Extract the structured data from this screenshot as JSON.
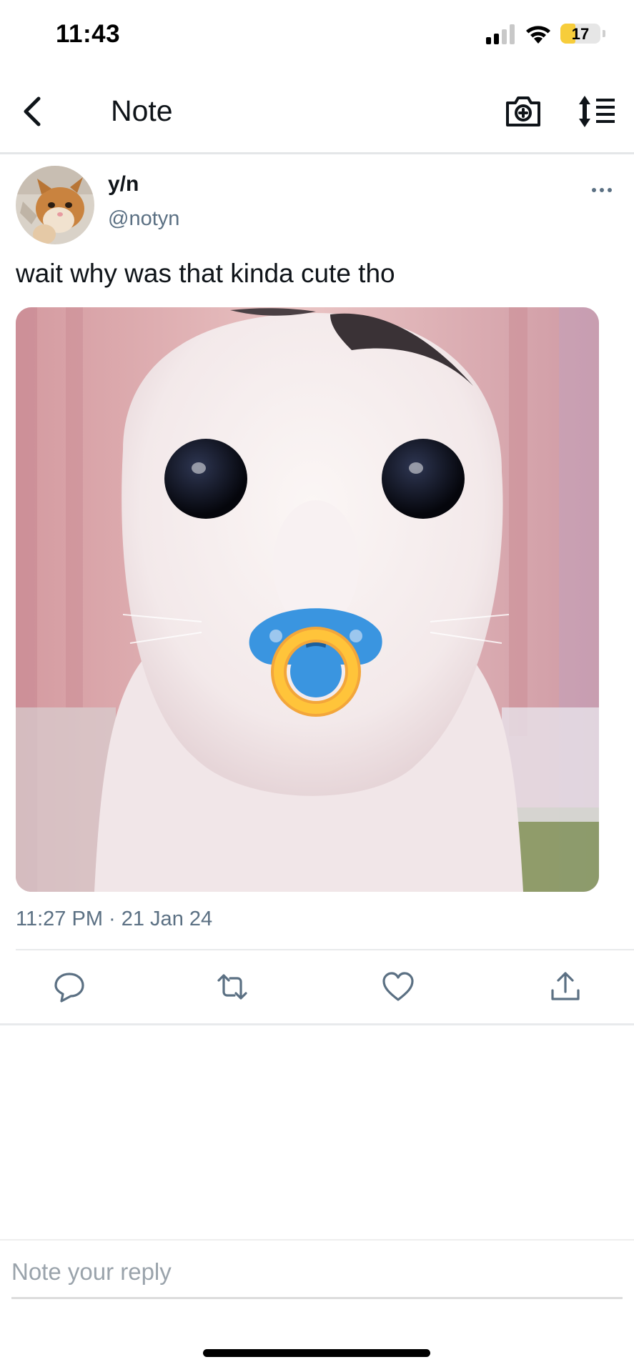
{
  "status_bar": {
    "time": "11:43",
    "battery_level": "17",
    "battery_fraction": 0.17,
    "battery_color": "#f7cd3b"
  },
  "header": {
    "title": "Note",
    "back_icon": "chevron-left-icon",
    "camera_icon": "camera-plus-icon",
    "sort_icon": "sort-list-icon"
  },
  "post": {
    "author_name": "y/n",
    "author_handle": "@notyn",
    "text": "wait why was that kinda cute tho",
    "timestamp": "11:27 PM · 21 Jan 24",
    "more_icon": "more-horizontal-icon",
    "image_description_icon": "photo"
  },
  "actions": [
    {
      "name": "reply",
      "icon": "comment-icon"
    },
    {
      "name": "repost",
      "icon": "repost-icon"
    },
    {
      "name": "like",
      "icon": "heart-icon"
    },
    {
      "name": "share",
      "icon": "share-icon"
    }
  ],
  "reply": {
    "placeholder": "Note your reply"
  },
  "colors": {
    "secondary_text": "#5b7083",
    "primary_text": "#0f1419",
    "divider": "#e8eaec"
  }
}
